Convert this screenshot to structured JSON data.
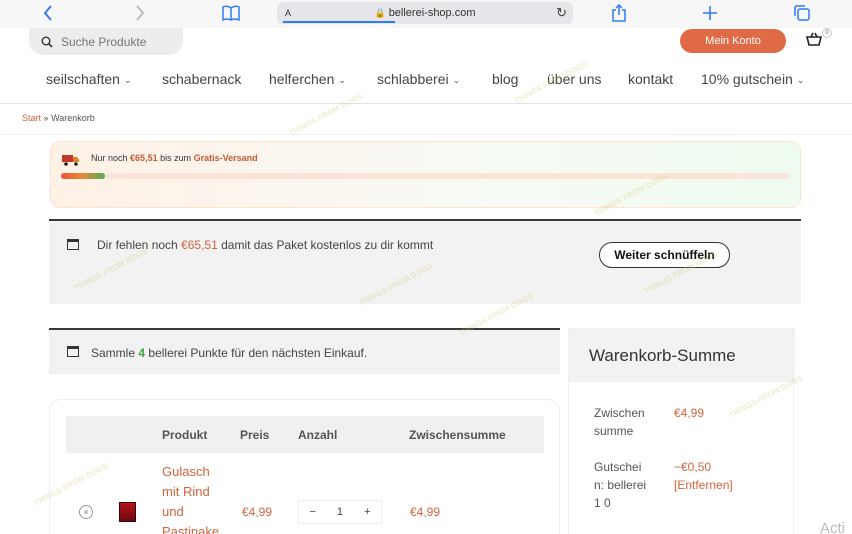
{
  "browser": {
    "url": "bellerei-shop.com",
    "text_size_label": "A",
    "back_icon": "chevron-left-icon",
    "forward_icon": "chevron-right-icon",
    "bookmarks_icon": "book-icon",
    "share_icon": "share-icon",
    "new_tab_icon": "plus-icon",
    "tabs_icon": "tabs-icon",
    "accent": "#2f7bf6"
  },
  "header": {
    "search_placeholder": "Suche Produkte",
    "account_label": "Mein Konto",
    "cart_count": "0",
    "nav": [
      {
        "label": "seilschaften",
        "has_dropdown": true
      },
      {
        "label": "schabernack",
        "has_dropdown": false
      },
      {
        "label": "helferchen",
        "has_dropdown": true
      },
      {
        "label": "schlabberei",
        "has_dropdown": true
      },
      {
        "label": "blog",
        "has_dropdown": false
      },
      {
        "label": "über uns",
        "has_dropdown": false
      },
      {
        "label": "kontakt",
        "has_dropdown": false
      },
      {
        "label": "10% gutschein",
        "has_dropdown": true
      }
    ],
    "brand_color": "#e06a45"
  },
  "breadcrumb": {
    "start": "Start",
    "separator": "»",
    "current": "Warenkorb"
  },
  "shipping_notice": {
    "prefix": "Nur noch",
    "amount": "€65,51",
    "middle": "bis zum",
    "target": "Gratis-Versand",
    "progress_fraction": 0.06
  },
  "info_box": {
    "prefix": "Dir fehlen noch",
    "amount": "€65,51",
    "suffix": "damit das Paket kostenlos zu dir kommt",
    "button_label": "Weiter schnüffeln"
  },
  "points_box": {
    "prefix": "Sammle",
    "points": "4",
    "suffix": "bellerei Punkte für den nächsten Einkauf."
  },
  "cart_table": {
    "headers": [
      "Produkt",
      "Preis",
      "Anzahl",
      "Zwischensumme"
    ],
    "rows": [
      {
        "product": "Gulasch mit Rind und Pastinake",
        "price": "€4,99",
        "quantity": "1",
        "subtotal": "€4,99"
      }
    ],
    "qty_minus": "−",
    "qty_plus": "+",
    "remove_symbol": "×"
  },
  "totals": {
    "title": "Warenkorb-Summe",
    "subtotal_label": "Zwischen summe",
    "subtotal_value": "€4,99",
    "coupon_label": "Gutschei n: bellerei1 0",
    "coupon_value": "−€0,50",
    "coupon_remove": "[Entfernen]"
  },
  "corner_text": "Acti",
  "watermark_text": "THINGS FROM DOGS"
}
